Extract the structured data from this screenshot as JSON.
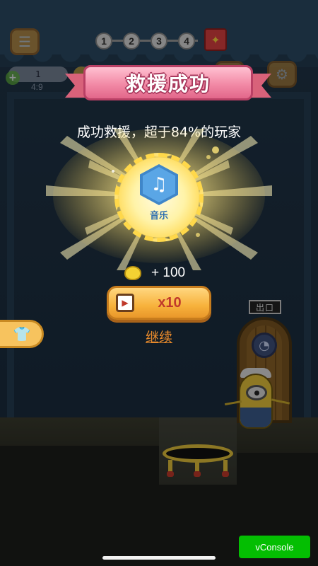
{
  "hud": {
    "menu_icon": "list-icon",
    "levels": [
      "1",
      "2",
      "3",
      "4"
    ],
    "gift_icon": "gift-icon",
    "energy_value": "1",
    "timer": "4:9",
    "settings_icon": "gear-icon"
  },
  "scene": {
    "exit_sign": "出口"
  },
  "popup": {
    "title": "救援成功",
    "subtitle": "成功救援，超于84%的玩家",
    "badge_icon": "music-note-icon",
    "badge_label": "音乐",
    "reward_icon": "coin-icon",
    "reward_text": "+ 100",
    "video_button_label": "x10",
    "video_icon": "video-play-icon",
    "continue_label": "继续"
  },
  "side_button": {
    "icon": "shirt-icon"
  },
  "debug": {
    "vconsole_label": "vConsole"
  },
  "colors": {
    "ribbon_pink": "#f28aa6",
    "button_orange": "#f7b23c",
    "link_orange": "#e88a2b",
    "vconsole_green": "#04be02"
  }
}
